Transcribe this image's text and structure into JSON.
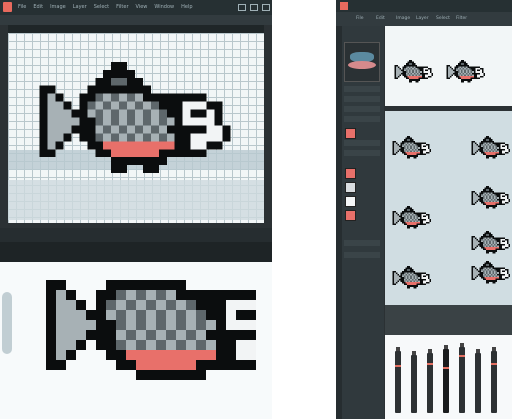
{
  "left_window": {
    "menu_items": [
      "File",
      "Edit",
      "Image",
      "Layer",
      "Select",
      "Filter",
      "View",
      "Window",
      "Help"
    ],
    "tab_label": "",
    "status_left": "",
    "status_right": ""
  },
  "right_window": {
    "menu_items": [
      "File",
      "Edit",
      "Image",
      "Layer",
      "Select",
      "Filter",
      "View",
      "Window"
    ],
    "option_labels": [
      "",
      "",
      "",
      "",
      ""
    ]
  },
  "colors": {
    "fish_dark": "#0b0d0e",
    "fish_mid": "#5e676b",
    "fish_light": "#a7b1b5",
    "fish_white": "#f2f4f5",
    "fish_pink": "#e8706a",
    "ui_dark": "#2b3134"
  },
  "icons": [
    "app-logo-icon",
    "minimize-icon",
    "maximize-icon",
    "close-icon"
  ]
}
